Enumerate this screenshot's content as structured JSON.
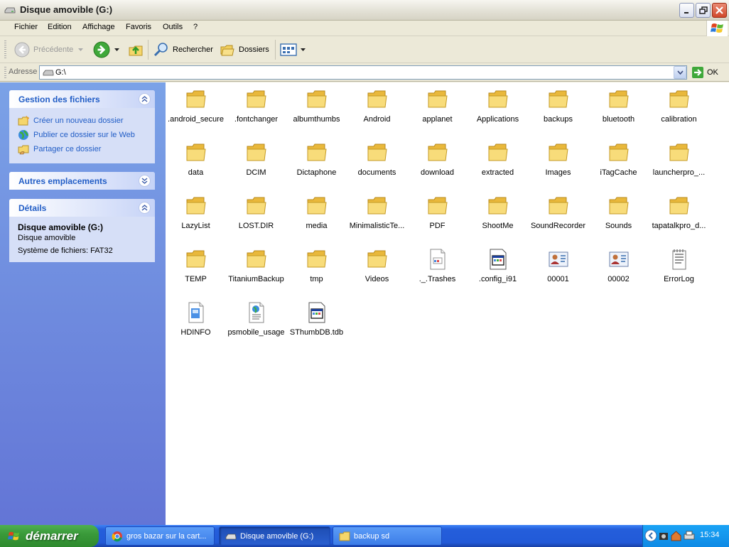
{
  "window": {
    "title": "Disque amovible (G:)"
  },
  "menu": [
    "Fichier",
    "Edition",
    "Affichage",
    "Favoris",
    "Outils",
    "?"
  ],
  "toolbar": {
    "back": "Précédente",
    "search": "Rechercher",
    "folders": "Dossiers"
  },
  "address": {
    "label": "Adresse",
    "value": "G:\\",
    "go": "OK"
  },
  "left_panel": {
    "file_tasks": {
      "title": "Gestion des fichiers",
      "items": [
        "Créer un nouveau dossier",
        "Publier ce dossier sur le Web",
        "Partager ce dossier"
      ]
    },
    "other_places": {
      "title": "Autres emplacements"
    },
    "details": {
      "title": "Détails",
      "name": "Disque amovible (G:)",
      "type": "Disque amovible",
      "fs": "Système de fichiers: FAT32"
    }
  },
  "items": [
    {
      "name": ".android_secure",
      "type": "folder"
    },
    {
      "name": ".fontchanger",
      "type": "folder"
    },
    {
      "name": "albumthumbs",
      "type": "folder"
    },
    {
      "name": "Android",
      "type": "folder"
    },
    {
      "name": "applanet",
      "type": "folder"
    },
    {
      "name": "Applications",
      "type": "folder"
    },
    {
      "name": "backups",
      "type": "folder"
    },
    {
      "name": "bluetooth",
      "type": "folder"
    },
    {
      "name": "calibration",
      "type": "folder"
    },
    {
      "name": "data",
      "type": "folder"
    },
    {
      "name": "DCIM",
      "type": "folder"
    },
    {
      "name": "Dictaphone",
      "type": "folder"
    },
    {
      "name": "documents",
      "type": "folder"
    },
    {
      "name": "download",
      "type": "folder"
    },
    {
      "name": "extracted",
      "type": "folder"
    },
    {
      "name": "Images",
      "type": "folder"
    },
    {
      "name": "iTagCache",
      "type": "folder"
    },
    {
      "name": "launcherpro_...",
      "type": "folder"
    },
    {
      "name": "LazyList",
      "type": "folder"
    },
    {
      "name": "LOST.DIR",
      "type": "folder"
    },
    {
      "name": "media",
      "type": "folder"
    },
    {
      "name": "MinimalisticTe...",
      "type": "folder"
    },
    {
      "name": "PDF",
      "type": "folder"
    },
    {
      "name": "ShootMe",
      "type": "folder"
    },
    {
      "name": "SoundRecorder",
      "type": "folder"
    },
    {
      "name": "Sounds",
      "type": "folder"
    },
    {
      "name": "tapatalkpro_d...",
      "type": "folder"
    },
    {
      "name": "TEMP",
      "type": "folder"
    },
    {
      "name": "TitaniumBackup",
      "type": "folder"
    },
    {
      "name": "tmp",
      "type": "folder"
    },
    {
      "name": "Videos",
      "type": "folder"
    },
    {
      "name": "._.Trashes",
      "type": "file-generic"
    },
    {
      "name": ".config_i91",
      "type": "file-app"
    },
    {
      "name": "00001",
      "type": "file-contact"
    },
    {
      "name": "00002",
      "type": "file-contact"
    },
    {
      "name": "ErrorLog",
      "type": "file-text"
    },
    {
      "name": "HDINFO",
      "type": "file-doc"
    },
    {
      "name": "psmobile_usage",
      "type": "file-web"
    },
    {
      "name": "SThumbDB.tdb",
      "type": "file-app"
    }
  ],
  "taskbar": {
    "start": "démarrer",
    "tasks": [
      {
        "label": "gros bazar sur la cart...",
        "icon": "chrome-icon"
      },
      {
        "label": "Disque amovible (G:)",
        "icon": "drive-icon"
      },
      {
        "label": "backup sd",
        "icon": "folder-icon"
      }
    ],
    "clock": "15:34"
  }
}
